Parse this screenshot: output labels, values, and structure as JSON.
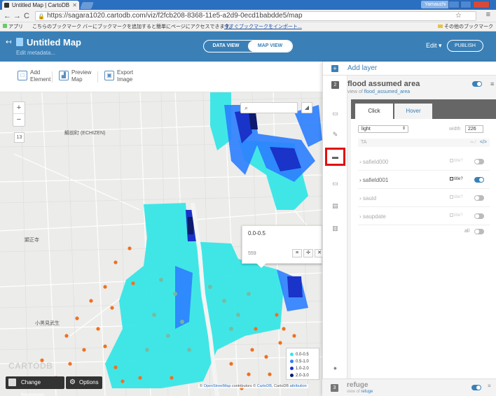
{
  "browser": {
    "tab_title": "Untitled Map | CartoDB",
    "user_chip": "Yamauchi",
    "url": "https://sagara1020.cartodb.com/viz/f2fcb208-8368-11e5-a2d9-0ecd1babdde5/map",
    "bookmarks_apps": "アプリ",
    "bookmarks_text": "こちらのブックマーク バーにブックマークを追加すると簡単にページにアクセスできます。",
    "bookmarks_import": "今すぐブックマークをインポート...",
    "bookmarks_other": "その他のブックマーク"
  },
  "header": {
    "title": "Untitled Map",
    "edit_metadata": "Edit metadata...",
    "data_view": "DATA VIEW",
    "map_view": "MAP VIEW",
    "edit": "Edit",
    "publish": "PUBLISH"
  },
  "toolbar": {
    "add_element": "Add\nElement",
    "add_element_l1": "Add",
    "add_element_l2": "Element",
    "preview_l1": "Preview",
    "preview_l2": "Map",
    "export_l1": "Export",
    "export_l2": "Image"
  },
  "map": {
    "zoom_in": "+",
    "zoom_out": "−",
    "zoom_level": "13",
    "label_echizen": "鯖前町 (ECHIZEN)",
    "label_2": "顕正寺",
    "label_3": "小黒見武生",
    "infowindow_title": "0.0-0.5",
    "infowindow_value": "559",
    "legend": [
      {
        "label": "0.0-0.5",
        "color": "#37e6e6"
      },
      {
        "label": "0.5-1.0",
        "color": "#2c7fff"
      },
      {
        "label": "1.0-2.0",
        "color": "#1a33c8"
      },
      {
        "label": "2.0-3.0",
        "color": "#0d1a6e"
      }
    ],
    "change_basemap": "Change basemap",
    "options": "Options",
    "logo": "CARTODB",
    "attribution_prefix": "© ",
    "attribution_osm": "OpenStreetMap",
    "attribution_mid": " contributors © ",
    "attribution_cartodb": "CartoDB",
    "attribution_suffix": ", CartoDB ",
    "attribution_link": "attribution"
  },
  "panel": {
    "add_layer": "Add layer",
    "layer_number": "2",
    "layer_title": "flood assumed area",
    "layer_view_of": "view of ",
    "layer_table": "flood_assumed_area",
    "tab_click": "Click",
    "tab_hover": "Hover",
    "theme": "light",
    "width_label": "width",
    "width_value": "226",
    "header_row_label": "TA",
    "code_label": "</>",
    "fields": [
      {
        "name": "safield000",
        "title": "title?",
        "on": false
      },
      {
        "name": "safield001",
        "title": "title?",
        "on": true
      },
      {
        "name": "sauid",
        "title": "title?",
        "on": false
      },
      {
        "name": "saupdate",
        "title": "title?",
        "on": false
      }
    ],
    "all_label": "all",
    "refuge_number": "3",
    "refuge_title": "refuge",
    "refuge_view_of": "view of ",
    "refuge_table": "refuge"
  },
  "colors": {
    "accent": "#3a80b7",
    "flood_light": "#37e6e6",
    "flood_mid": "#2c7fff",
    "flood_dark": "#1a33c8",
    "flood_darkest": "#0d1a6e",
    "refuge_point": "#f07020",
    "highlight_box": "#e01010"
  }
}
